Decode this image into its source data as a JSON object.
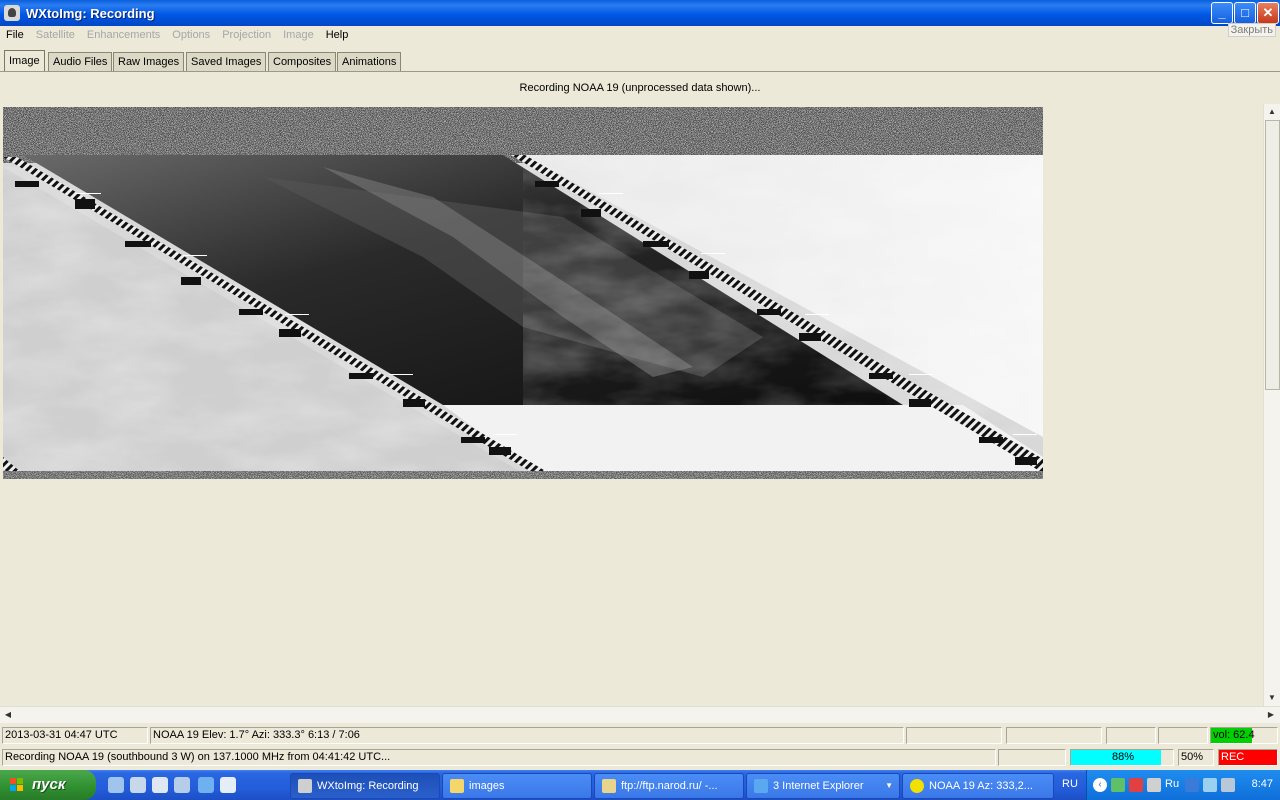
{
  "window": {
    "title": "WXtoImg: Recording",
    "close_tooltip": "Закрыть",
    "buttons": {
      "minimize": "_",
      "maximize": "□",
      "close": "✕"
    }
  },
  "menu": [
    {
      "label": "File",
      "enabled": true
    },
    {
      "label": "Satellite",
      "enabled": false
    },
    {
      "label": "Enhancements",
      "enabled": false
    },
    {
      "label": "Options",
      "enabled": false
    },
    {
      "label": "Projection",
      "enabled": false
    },
    {
      "label": "Image",
      "enabled": false
    },
    {
      "label": "Help",
      "enabled": true
    }
  ],
  "tabs": [
    "Image",
    "Audio Files",
    "Raw Images",
    "Saved Images",
    "Composites",
    "Animations"
  ],
  "active_tab": "Image",
  "caption": "Recording NOAA 19 (unprocessed data shown)...",
  "status_row1": {
    "datetime": "2013-03-31  04:47 UTC",
    "satellite_info": "NOAA 19   Elev: 1.7°   Azi: 333.3°   6:13 / 7:06",
    "volume": "vol: 62.4"
  },
  "status_row2": {
    "message": "Recording NOAA 19 (southbound 3 W) on 137.1000 MHz from 04:41:42 UTC...",
    "signal_percent": "88%",
    "signal_level": 0.88,
    "zoom": "50%",
    "rec_label": "REC"
  },
  "colors": {
    "titlebar": "#0058e6",
    "signal_bar": "#00ffff",
    "volume_bar": "#00d000",
    "rec": "#ff0000"
  },
  "taskbar": {
    "start_label": "пуск",
    "tasks": [
      {
        "label": "WXtoImg: Recording",
        "active": true
      },
      {
        "label": "images",
        "active": false
      },
      {
        "label": "ftp://ftp.narod.ru/ -...",
        "active": false
      },
      {
        "label": "3 Internet Explorer",
        "active": false
      },
      {
        "label": "NOAA 19  Az: 333,2...",
        "active": false
      }
    ],
    "language": "RU",
    "tray_lang": "Ru",
    "clock": "8:47"
  }
}
